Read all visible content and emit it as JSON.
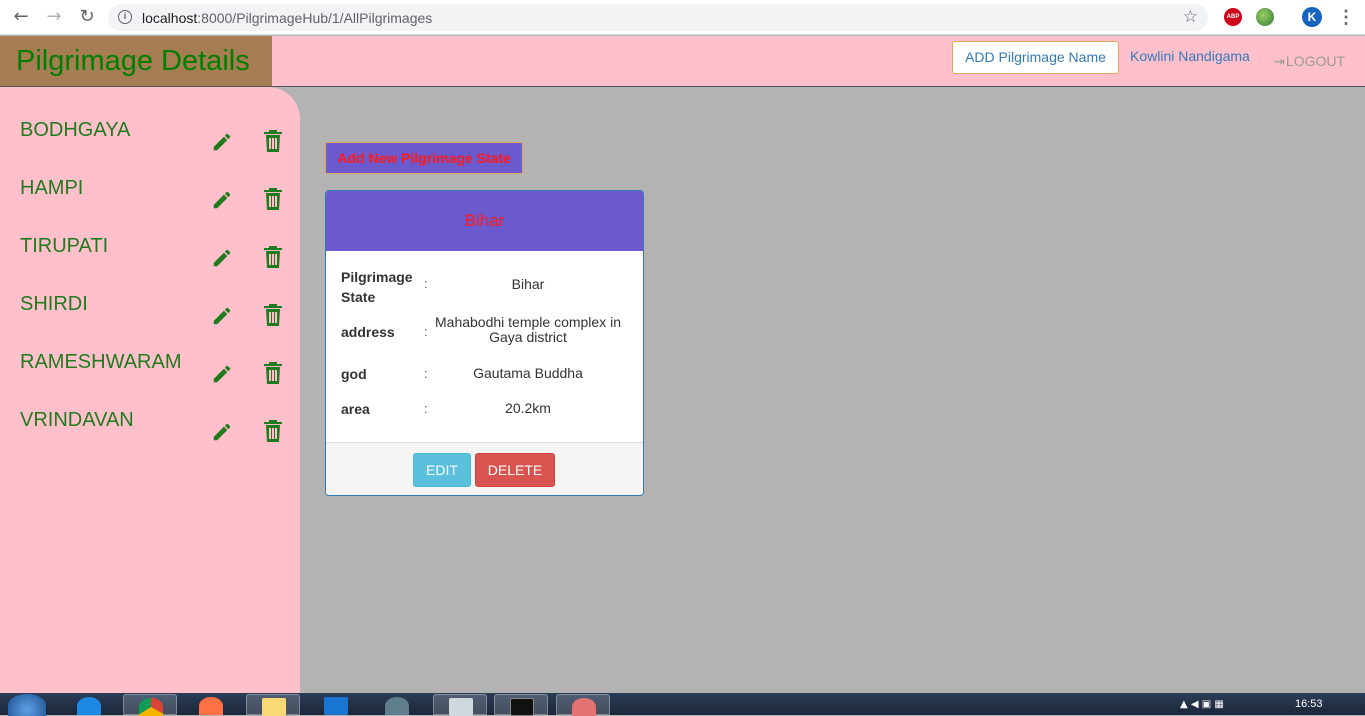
{
  "browser": {
    "url_host": "localhost",
    "url_rest": ":8000/PilgrimageHub/1/AllPilgrimages",
    "back_icon": "back-arrow-icon",
    "forward_icon": "forward-arrow-icon",
    "reload_icon": "reload-icon",
    "ext_abp_label": "ABP",
    "avatar_letter": "K"
  },
  "header": {
    "title": "Pilgrimage Details",
    "add_button": "ADD Pilgrimage Name",
    "user_name": "Kowlini Nandigama",
    "logout": "LOGOUT"
  },
  "sidebar": {
    "items": [
      {
        "label": "BODHGAYA"
      },
      {
        "label": "HAMPI"
      },
      {
        "label": "TIRUPATI"
      },
      {
        "label": "SHIRDI"
      },
      {
        "label": "RAMESHWARAM"
      },
      {
        "label": "VRINDAVAN"
      }
    ]
  },
  "main": {
    "add_state_button": "Add New Pilgrimage State",
    "card": {
      "title": "Bihar",
      "rows": [
        {
          "label": "Pilgrimage State",
          "sep": ":",
          "value": "Bihar"
        },
        {
          "label": "address",
          "sep": ":",
          "value": "Mahabodhi temple complex in Gaya district"
        },
        {
          "label": "god",
          "sep": ":",
          "value": "Gautama Buddha"
        },
        {
          "label": "area",
          "sep": ":",
          "value": "20.2km"
        }
      ],
      "edit_button": "EDIT",
      "delete_button": "DELETE"
    }
  },
  "taskbar": {
    "clock": "16:53"
  },
  "colors": {
    "header_bg": "#ffc0cb",
    "brand_bg": "#a67c52",
    "brand_text": "#008000",
    "card_head_bg": "#6a5acd",
    "card_head_text": "#ff1a1a",
    "edit_btn": "#5bc0de",
    "delete_btn": "#d9534f",
    "icon_green": "#1e7b1e"
  }
}
